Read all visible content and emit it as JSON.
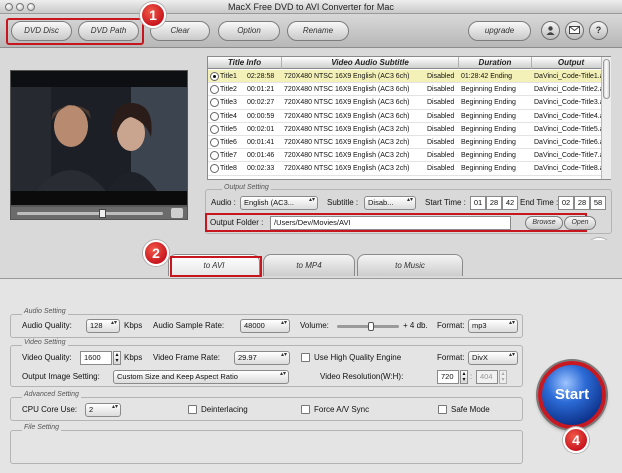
{
  "window": {
    "title": "MacX Free DVD to AVI  Converter for Mac"
  },
  "toolbar": {
    "dvd_disc": "DVD Disc",
    "dvd_path": "DVD Path",
    "clear": "Clear",
    "option": "Option",
    "rename": "Rename",
    "upgrade": "upgrade",
    "user_icon": "person-icon",
    "mail_icon": "mail-icon",
    "help_icon": "?"
  },
  "badges": {
    "b1": "1",
    "b2": "2",
    "b3": "3",
    "b4": "4"
  },
  "table": {
    "headers": [
      "Title Info",
      "Video Audio Subtitle",
      "Duration",
      "Output"
    ],
    "rows": [
      {
        "title": "Title1",
        "time": "02:28:58",
        "video": "720X480 NTSC 16X9",
        "audio": "English (AC3 6ch)",
        "sub": "Disabled",
        "duration": "01:28:42 Ending",
        "output": "DaVinci_Code-Title1.a",
        "selected": true
      },
      {
        "title": "Title2",
        "time": "00:01:21",
        "video": "720X480 NTSC 16X9",
        "audio": "English (AC3 6ch)",
        "sub": "Disabled",
        "duration": "Beginning Ending",
        "output": "DaVinci_Code-Title2.a",
        "selected": false
      },
      {
        "title": "Title3",
        "time": "00:02:27",
        "video": "720X480 NTSC 16X9",
        "audio": "English (AC3 6ch)",
        "sub": "Disabled",
        "duration": "Beginning Ending",
        "output": "DaVinci_Code-Title3.a",
        "selected": false
      },
      {
        "title": "Title4",
        "time": "00:00:59",
        "video": "720X480 NTSC 16X9",
        "audio": "English (AC3 6ch)",
        "sub": "Disabled",
        "duration": "Beginning Ending",
        "output": "DaVinci_Code-Title4.a",
        "selected": false
      },
      {
        "title": "Title5",
        "time": "00:02:01",
        "video": "720X480 NTSC 16X9",
        "audio": "English (AC3 2ch)",
        "sub": "Disabled",
        "duration": "Beginning Ending",
        "output": "DaVinci_Code-Title5.a",
        "selected": false
      },
      {
        "title": "Title6",
        "time": "00:01:41",
        "video": "720X480 NTSC 16X9",
        "audio": "English (AC3 2ch)",
        "sub": "Disabled",
        "duration": "Beginning Ending",
        "output": "DaVinci_Code-Title6.a",
        "selected": false
      },
      {
        "title": "Title7",
        "time": "00:01:46",
        "video": "720X480 NTSC 16X9",
        "audio": "English (AC3 2ch)",
        "sub": "Disabled",
        "duration": "Beginning Ending",
        "output": "DaVinci_Code-Title7.a",
        "selected": false
      },
      {
        "title": "Title8",
        "time": "00:02:33",
        "video": "720X480 NTSC 16X9",
        "audio": "English (AC3 2ch)",
        "sub": "Disabled",
        "duration": "Beginning Ending",
        "output": "DaVinci_Code-Title8.a",
        "selected": false
      }
    ]
  },
  "output_setting": {
    "legend": "Output Setting",
    "audio_label": "Audio :",
    "audio_value": "English (AC3...",
    "subtitle_label": "Subtitle :",
    "subtitle_value": "Disab...",
    "start_time_label": "Start Time :",
    "start_time": [
      "01",
      "28",
      "42"
    ],
    "end_time_label": "End Time :",
    "end_time": [
      "02",
      "28",
      "58"
    ],
    "output_folder_label": "Output Folder :",
    "output_folder_value": "/Users/Dev/Movies/AVI",
    "browse": "Browse",
    "open": "Open"
  },
  "tabs": [
    "to AVI",
    "to MP4",
    "to Music"
  ],
  "audio_setting": {
    "legend": "Audio Setting",
    "quality_label": "Audio Quality:",
    "quality_value": "128",
    "quality_unit": "Kbps",
    "sample_rate_label": "Audio Sample Rate:",
    "sample_rate_value": "48000",
    "volume_label": "Volume:",
    "volume_value": "+ 4 db.",
    "volume_level": 0.55,
    "format_label": "Format:",
    "format_value": "mp3"
  },
  "video_setting": {
    "legend": "Video Setting",
    "quality_label": "Video Quality:",
    "quality_value": "1600",
    "quality_unit": "Kbps",
    "frame_rate_label": "Video Frame Rate:",
    "frame_rate_value": "29.97",
    "hq_engine_label": "Use High Quality Engine",
    "format_label": "Format:",
    "format_value": "DivX",
    "output_image_label": "Output Image Setting:",
    "output_image_value": "Custom Size and Keep Aspect Ratio",
    "resolution_label": "Video Resolution(W:H):",
    "res_w": "720",
    "res_h": "404"
  },
  "advanced_setting": {
    "legend": "Advanced Setting",
    "cpu_label": "CPU Core Use:",
    "cpu_value": "2",
    "deinterlacing": "Deinterlacing",
    "force_av": "Force A/V Sync",
    "safe_mode": "Safe Mode"
  },
  "file_setting": {
    "legend": "File Setting"
  },
  "start_button": "Start",
  "colors": {
    "accent_red": "#c8161e",
    "selected_row": "#f3f1b8",
    "start_blue": "#2c6bd6"
  }
}
